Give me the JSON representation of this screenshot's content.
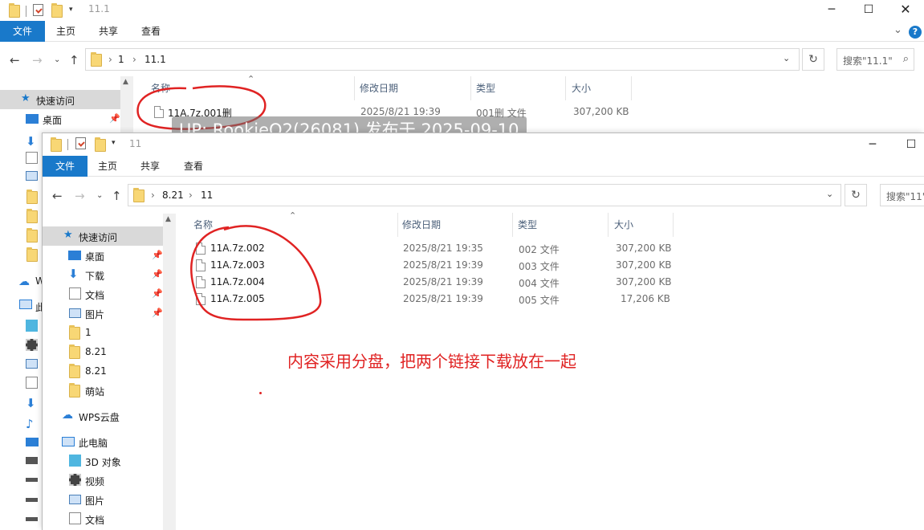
{
  "back_window": {
    "title": "11.1",
    "ribbon_tabs": [
      "文件",
      "主页",
      "共享",
      "查看"
    ],
    "breadcrumb": [
      "1",
      "11.1"
    ],
    "search_placeholder": "搜索\"11.1\"",
    "columns": [
      "名称",
      "修改日期",
      "类型",
      "大小"
    ],
    "nav": {
      "quick_access": "快速访问",
      "desktop": "桌面",
      "w_label": "W",
      "pc_label": "此"
    },
    "files": [
      {
        "name": "11A.7z.001删",
        "date": "2025/8/21 19:39",
        "type": "001删 文件",
        "size": "307,200 KB"
      }
    ]
  },
  "front_window": {
    "title": "11",
    "ribbon_tabs": [
      "文件",
      "主页",
      "共享",
      "查看"
    ],
    "breadcrumb": [
      "8.21",
      "11"
    ],
    "search_placeholder": "搜索\"11\"",
    "columns": [
      "名称",
      "修改日期",
      "类型",
      "大小"
    ],
    "nav": [
      {
        "label": "快速访问",
        "icon": "star-icon",
        "pinned": false
      },
      {
        "label": "桌面",
        "icon": "desktop-icon",
        "pinned": true
      },
      {
        "label": "下载",
        "icon": "download-icon",
        "pinned": true
      },
      {
        "label": "文档",
        "icon": "document-icon",
        "pinned": true
      },
      {
        "label": "图片",
        "icon": "picture-icon",
        "pinned": true
      },
      {
        "label": "1",
        "icon": "folder-icon",
        "pinned": false
      },
      {
        "label": "8.21",
        "icon": "folder-icon",
        "pinned": false
      },
      {
        "label": "8.21",
        "icon": "folder-icon",
        "pinned": false
      },
      {
        "label": "萌站",
        "icon": "folder-icon",
        "pinned": false
      },
      {
        "label": "WPS云盘",
        "icon": "cloud-icon",
        "pinned": false
      },
      {
        "label": "此电脑",
        "icon": "computer-icon",
        "pinned": false
      },
      {
        "label": "3D 对象",
        "icon": "cube-icon",
        "pinned": false
      },
      {
        "label": "视频",
        "icon": "video-icon",
        "pinned": false
      },
      {
        "label": "图片",
        "icon": "picture-icon",
        "pinned": false
      },
      {
        "label": "文档",
        "icon": "document-icon",
        "pinned": false
      }
    ],
    "files": [
      {
        "name": "11A.7z.002",
        "date": "2025/8/21 19:35",
        "type": "002 文件",
        "size": "307,200 KB"
      },
      {
        "name": "11A.7z.003",
        "date": "2025/8/21 19:39",
        "type": "003 文件",
        "size": "307,200 KB"
      },
      {
        "name": "11A.7z.004",
        "date": "2025/8/21 19:39",
        "type": "004 文件",
        "size": "307,200 KB"
      },
      {
        "name": "11A.7z.005",
        "date": "2025/8/21 19:39",
        "type": "005 文件",
        "size": "17,206 KB"
      }
    ]
  },
  "watermark": "UP: RookieO2(26081) 发布于 2025-09-10",
  "annotation_note": "内容采用分盘，把两个链接下载放在一起",
  "colors": {
    "accent": "#1979ca",
    "annotation": "#e02323",
    "selection": "#d9d9d9"
  }
}
